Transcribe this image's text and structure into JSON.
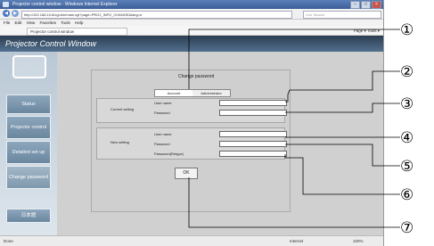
{
  "browser": {
    "title": "Projector control window - Windows Internet Explorer",
    "url": "http://192.168.10.8/cgi-bin/main.cgi?page=PROJ_INFO_CHANGE&lang=e",
    "search_placeholder": "Live Search",
    "menu": [
      "File",
      "Edit",
      "View",
      "Favorites",
      "Tools",
      "Help"
    ],
    "tab_label": "Projector control window",
    "tools_label": "Page ▾  Tools ▾",
    "status_left": "Done",
    "status_zone": "Internet",
    "status_zoom": "100%"
  },
  "app": {
    "header_title": "Projector Control Window",
    "nav": [
      {
        "label": "Status"
      },
      {
        "label": "Projector control"
      },
      {
        "label": "Detailed set up"
      },
      {
        "label": "Change password"
      },
      {
        "label": "日本語"
      }
    ]
  },
  "page": {
    "title": "Change password",
    "tabs": [
      "Account",
      "Administrator"
    ],
    "current_setting": {
      "label": "Current setting",
      "fields": [
        {
          "label": "User name",
          "value": ""
        },
        {
          "label": "Password",
          "value": ""
        }
      ]
    },
    "new_setting": {
      "label": "New setting",
      "fields": [
        {
          "label": "User name",
          "value": ""
        },
        {
          "label": "Password",
          "value": ""
        },
        {
          "label": "Password(Retype)",
          "value": ""
        }
      ]
    },
    "ok_label": "OK"
  },
  "callouts": [
    "①",
    "②",
    "③",
    "④",
    "⑤",
    "⑥",
    "⑦"
  ]
}
